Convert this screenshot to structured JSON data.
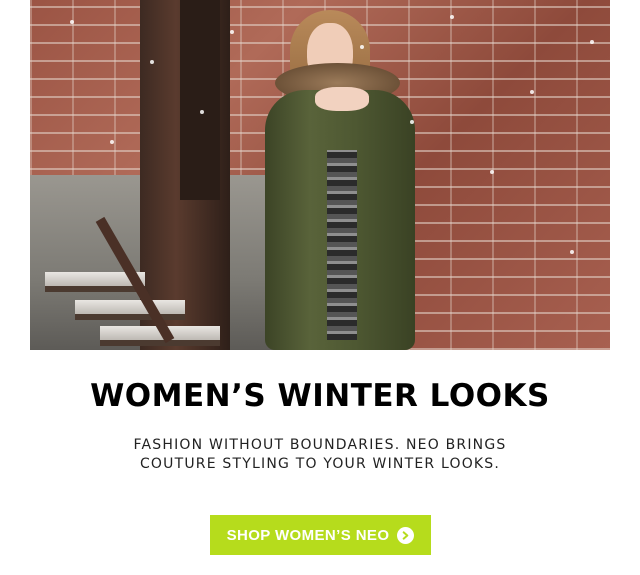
{
  "hero": {
    "alt": "Woman in olive winter parka blowing a kiss in the snow"
  },
  "headline": "WOMEN’S WINTER LOOKS",
  "subcopy": {
    "line1": "FASHION WITHOUT BOUNDARIES. NEO BRINGS",
    "line2": "COUTURE STYLING TO YOUR WINTER LOOKS."
  },
  "cta": {
    "label": "SHOP WOMEN’S NEO",
    "icon": "chevron-right-circle-icon",
    "color": "#b6dc1c",
    "text_color": "#ffffff"
  }
}
